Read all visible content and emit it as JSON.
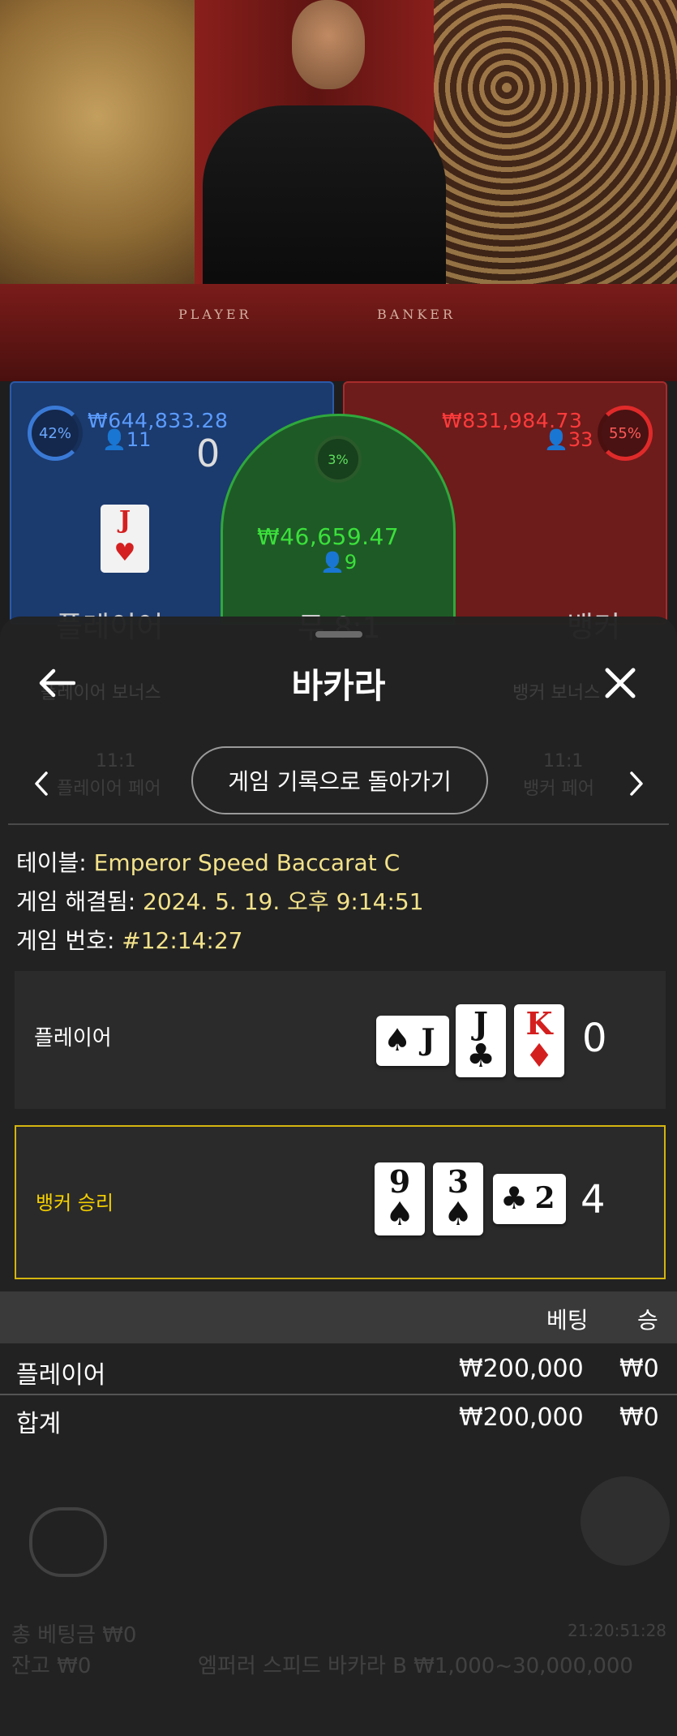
{
  "video": {
    "player_label": "PLAYER",
    "banker_label": "BANKER"
  },
  "board": {
    "player": {
      "percent": "42%",
      "amount": "₩644,833.28",
      "count": "11",
      "score": "0",
      "card_rank": "J",
      "card_suit": "♥",
      "label": "플레이어"
    },
    "tie": {
      "percent": "3%",
      "amount": "₩46,659.47",
      "count": "9",
      "label": "무 8:1"
    },
    "banker": {
      "percent": "55%",
      "amount": "₩831,984.73",
      "count": "33",
      "label": "뱅커"
    }
  },
  "sheet": {
    "title": "바카라",
    "back_icon": "arrow-left-icon",
    "close_icon": "close-icon",
    "back_to_history": "게임 기록으로 돌아가기",
    "ghost_left_top": "플레이어 보너스",
    "ghost_left_odds": "11:1",
    "ghost_left_bottom": "플레이어 페어",
    "ghost_right_top": "뱅커 보너스",
    "ghost_right_odds": "11:1",
    "ghost_right_bottom": "뱅커 페어",
    "info": {
      "table_label": "테이블:",
      "table_value": "Emperor Speed Baccarat C",
      "resolved_label": "게임 해결됨:",
      "resolved_value": "2024. 5. 19. 오후 9:14:51",
      "number_label": "게임 번호:",
      "number_value": "#12:14:27"
    },
    "player_hand": {
      "label": "플레이어",
      "score": "0",
      "cards": [
        {
          "rank": "J",
          "suit": "♠",
          "color": "black",
          "sideways": true
        },
        {
          "rank": "J",
          "suit": "♣",
          "color": "black",
          "sideways": false
        },
        {
          "rank": "K",
          "suit": "♦",
          "color": "red",
          "sideways": false
        }
      ]
    },
    "banker_hand": {
      "label": "뱅커 승리",
      "score": "4",
      "cards": [
        {
          "rank": "9",
          "suit": "♠",
          "color": "black",
          "sideways": false
        },
        {
          "rank": "3",
          "suit": "♠",
          "color": "black",
          "sideways": false
        },
        {
          "rank": "2",
          "suit": "♣",
          "color": "black",
          "sideways": true
        }
      ]
    },
    "bets": {
      "col_bet": "베팅",
      "col_win": "승",
      "rows": [
        {
          "name": "플레이어",
          "bet": "₩200,000",
          "win": "₩0"
        }
      ],
      "total": {
        "name": "합계",
        "bet": "₩200,000",
        "win": "₩0"
      }
    },
    "footer": {
      "total_bet": "총 베팅금 ₩0",
      "balance": "잔고 ₩0",
      "table_limit": "엠퍼러 스피드 바카라 B ₩1,000~30,000,000",
      "time": "21:20:51:28"
    }
  },
  "colors": {
    "player_blue": "#3a7ad6",
    "banker_red": "#e02a2a",
    "tie_green": "#2fa83c",
    "highlight_yellow": "#d4b50f",
    "info_value": "#f3e28a"
  }
}
